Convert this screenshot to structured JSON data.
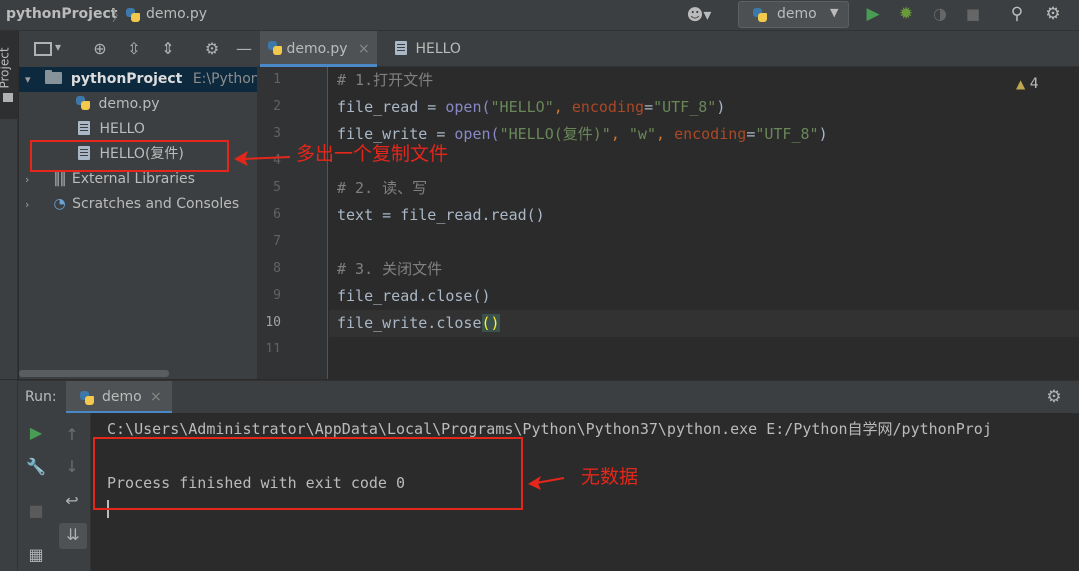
{
  "navbar": {
    "project_name": "pythonProject",
    "current_file": "demo.py",
    "run_config": "demo",
    "icons": [
      "user-icon",
      "run-icon",
      "debug-icon",
      "coverage-icon",
      "stop-icon",
      "search-icon",
      "gear-icon"
    ]
  },
  "project_panel": {
    "tab_label": "Project",
    "root": {
      "name": "pythonProject",
      "path": "E:\\Python自"
    },
    "files": [
      "demo.py",
      "HELLO",
      "HELLO(复件)"
    ],
    "external_libraries": "External Libraries",
    "scratches": "Scratches and Consoles"
  },
  "editor": {
    "tabs": [
      {
        "label": "demo.py",
        "close": "×"
      },
      {
        "label": "HELLO"
      }
    ],
    "warning_count": "4",
    "line_numbers": [
      "1",
      "2",
      "3",
      "4",
      "5",
      "6",
      "7",
      "8",
      "9",
      "10",
      "11"
    ],
    "lines": {
      "l1": "# 1.打开文件",
      "l2_var": "file_read",
      "l2_op": " = ",
      "l2_fn": "open(",
      "l2_arg": "\"HELLO\"",
      "l2_comma": ", ",
      "l2_param": "encoding",
      "l2_eq": "=",
      "l2_val": "\"UTF_8\"",
      "l2_end": ")",
      "l3_var": "file_write",
      "l3_op": " = ",
      "l3_fn": "open(",
      "l3_arg": "\"HELLO(复件)\"",
      "l3_comma": ", ",
      "l3_arg2": "\"w\"",
      "l3_comma2": ", ",
      "l3_param": "encoding",
      "l3_eq": "=",
      "l3_val": "\"UTF_8\"",
      "l3_end": ")",
      "l5": "# 2. 读、写",
      "l6": "text = file_read.read()",
      "l8": "# 3. 关闭文件",
      "l9": "file_read.close()",
      "l10_a": "file_write.close",
      "l10_b": "()"
    }
  },
  "run_panel": {
    "label": "Run:",
    "tab": "demo",
    "close": "×",
    "console": [
      "C:\\Users\\Administrator\\AppData\\Local\\Programs\\Python\\Python37\\python.exe E:/Python自学网/pythonProj",
      "",
      "Process finished with exit code 0"
    ]
  },
  "annotations": {
    "copy_file": "多出一个复制文件",
    "no_data": "无数据"
  },
  "colors": {
    "annotation_red": "#e5261a",
    "run_green": "#499c54",
    "debug_green": "#6a9b3b"
  }
}
